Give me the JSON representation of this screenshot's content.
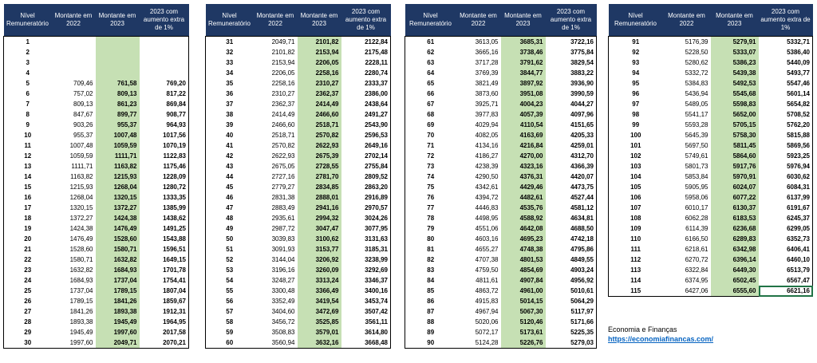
{
  "headers": {
    "level": "Nível Remuneratório",
    "amount2022": "Montante em 2022",
    "amount2023": "Montante em 2023",
    "amount2023_1pct": "2023 com aumento extra de 1%"
  },
  "tables": [
    {
      "rows": [
        [
          "1",
          "",
          "",
          ""
        ],
        [
          "2",
          "",
          "",
          ""
        ],
        [
          "3",
          "",
          "",
          ""
        ],
        [
          "4",
          "",
          "",
          ""
        ],
        [
          "5",
          "709,46",
          "761,58",
          "769,20"
        ],
        [
          "6",
          "757,02",
          "809,13",
          "817,22"
        ],
        [
          "7",
          "809,13",
          "861,23",
          "869,84"
        ],
        [
          "8",
          "847,67",
          "899,77",
          "908,77"
        ],
        [
          "9",
          "903,26",
          "955,37",
          "964,93"
        ],
        [
          "10",
          "955,37",
          "1007,48",
          "1017,56"
        ],
        [
          "11",
          "1007,48",
          "1059,59",
          "1070,19"
        ],
        [
          "12",
          "1059,59",
          "1111,71",
          "1122,83"
        ],
        [
          "13",
          "1111,71",
          "1163,82",
          "1175,46"
        ],
        [
          "14",
          "1163,82",
          "1215,93",
          "1228,09"
        ],
        [
          "15",
          "1215,93",
          "1268,04",
          "1280,72"
        ],
        [
          "16",
          "1268,04",
          "1320,15",
          "1333,35"
        ],
        [
          "17",
          "1320,15",
          "1372,27",
          "1385,99"
        ],
        [
          "18",
          "1372,27",
          "1424,38",
          "1438,62"
        ],
        [
          "19",
          "1424,38",
          "1476,49",
          "1491,25"
        ],
        [
          "20",
          "1476,49",
          "1528,60",
          "1543,88"
        ],
        [
          "21",
          "1528,60",
          "1580,71",
          "1596,51"
        ],
        [
          "22",
          "1580,71",
          "1632,82",
          "1649,15"
        ],
        [
          "23",
          "1632,82",
          "1684,93",
          "1701,78"
        ],
        [
          "24",
          "1684,93",
          "1737,04",
          "1754,41"
        ],
        [
          "25",
          "1737,04",
          "1789,15",
          "1807,04"
        ],
        [
          "26",
          "1789,15",
          "1841,26",
          "1859,67"
        ],
        [
          "27",
          "1841,26",
          "1893,38",
          "1912,31"
        ],
        [
          "28",
          "1893,38",
          "1945,49",
          "1964,95"
        ],
        [
          "29",
          "1945,49",
          "1997,60",
          "2017,58"
        ],
        [
          "30",
          "1997,60",
          "2049,71",
          "2070,21"
        ]
      ]
    },
    {
      "rows": [
        [
          "31",
          "2049,71",
          "2101,82",
          "2122,84"
        ],
        [
          "32",
          "2101,82",
          "2153,94",
          "2175,48"
        ],
        [
          "33",
          "2153,94",
          "2206,05",
          "2228,11"
        ],
        [
          "34",
          "2206,05",
          "2258,16",
          "2280,74"
        ],
        [
          "35",
          "2258,16",
          "2310,27",
          "2333,37"
        ],
        [
          "36",
          "2310,27",
          "2362,37",
          "2386,00"
        ],
        [
          "37",
          "2362,37",
          "2414,49",
          "2438,64"
        ],
        [
          "38",
          "2414,49",
          "2466,60",
          "2491,27"
        ],
        [
          "39",
          "2466,60",
          "2518,71",
          "2543,90"
        ],
        [
          "40",
          "2518,71",
          "2570,82",
          "2596,53"
        ],
        [
          "41",
          "2570,82",
          "2622,93",
          "2649,16"
        ],
        [
          "42",
          "2622,93",
          "2675,39",
          "2702,14"
        ],
        [
          "43",
          "2675,05",
          "2728,55",
          "2755,84"
        ],
        [
          "44",
          "2727,16",
          "2781,70",
          "2809,52"
        ],
        [
          "45",
          "2779,27",
          "2834,85",
          "2863,20"
        ],
        [
          "46",
          "2831,38",
          "2888,01",
          "2916,89"
        ],
        [
          "47",
          "2883,49",
          "2941,16",
          "2970,57"
        ],
        [
          "48",
          "2935,61",
          "2994,32",
          "3024,26"
        ],
        [
          "49",
          "2987,72",
          "3047,47",
          "3077,95"
        ],
        [
          "50",
          "3039,83",
          "3100,62",
          "3131,63"
        ],
        [
          "51",
          "3091,93",
          "3153,77",
          "3185,31"
        ],
        [
          "52",
          "3144,04",
          "3206,92",
          "3238,99"
        ],
        [
          "53",
          "3196,16",
          "3260,09",
          "3292,69"
        ],
        [
          "54",
          "3248,27",
          "3313,24",
          "3346,37"
        ],
        [
          "55",
          "3300,48",
          "3366,49",
          "3400,16"
        ],
        [
          "56",
          "3352,49",
          "3419,54",
          "3453,74"
        ],
        [
          "57",
          "3404,60",
          "3472,69",
          "3507,42"
        ],
        [
          "58",
          "3456,72",
          "3525,85",
          "3561,11"
        ],
        [
          "59",
          "3508,83",
          "3579,01",
          "3614,80"
        ],
        [
          "60",
          "3560,94",
          "3632,16",
          "3668,48"
        ]
      ]
    },
    {
      "rows": [
        [
          "61",
          "3613,05",
          "3685,31",
          "3722,16"
        ],
        [
          "62",
          "3665,16",
          "3738,46",
          "3775,84"
        ],
        [
          "63",
          "3717,28",
          "3791,62",
          "3829,54"
        ],
        [
          "64",
          "3769,39",
          "3844,77",
          "3883,22"
        ],
        [
          "65",
          "3821,49",
          "3897,92",
          "3936,90"
        ],
        [
          "66",
          "3873,60",
          "3951,08",
          "3990,59"
        ],
        [
          "67",
          "3925,71",
          "4004,23",
          "4044,27"
        ],
        [
          "68",
          "3977,83",
          "4057,39",
          "4097,96"
        ],
        [
          "69",
          "4029,94",
          "4110,54",
          "4151,65"
        ],
        [
          "70",
          "4082,05",
          "4163,69",
          "4205,33"
        ],
        [
          "71",
          "4134,16",
          "4216,84",
          "4259,01"
        ],
        [
          "72",
          "4186,27",
          "4270,00",
          "4312,70"
        ],
        [
          "73",
          "4238,39",
          "4323,16",
          "4366,39"
        ],
        [
          "74",
          "4290,50",
          "4376,31",
          "4420,07"
        ],
        [
          "75",
          "4342,61",
          "4429,46",
          "4473,75"
        ],
        [
          "76",
          "4394,72",
          "4482,61",
          "4527,44"
        ],
        [
          "77",
          "4446,83",
          "4535,76",
          "4581,12"
        ],
        [
          "78",
          "4498,95",
          "4588,92",
          "4634,81"
        ],
        [
          "79",
          "4551,06",
          "4642,08",
          "4688,50"
        ],
        [
          "80",
          "4603,16",
          "4695,23",
          "4742,18"
        ],
        [
          "81",
          "4655,27",
          "4748,38",
          "4795,86"
        ],
        [
          "82",
          "4707,38",
          "4801,53",
          "4849,55"
        ],
        [
          "83",
          "4759,50",
          "4854,69",
          "4903,24"
        ],
        [
          "84",
          "4811,61",
          "4907,84",
          "4956,92"
        ],
        [
          "85",
          "4863,72",
          "4961,00",
          "5010,61"
        ],
        [
          "86",
          "4915,83",
          "5014,15",
          "5064,29"
        ],
        [
          "87",
          "4967,94",
          "5067,30",
          "5117,97"
        ],
        [
          "88",
          "5020,06",
          "5120,46",
          "5171,66"
        ],
        [
          "89",
          "5072,17",
          "5173,61",
          "5225,35"
        ],
        [
          "90",
          "5124,28",
          "5226,76",
          "5279,03"
        ]
      ]
    },
    {
      "rows": [
        [
          "91",
          "5176,39",
          "5279,91",
          "5332,71"
        ],
        [
          "92",
          "5228,50",
          "5333,07",
          "5386,40"
        ],
        [
          "93",
          "5280,62",
          "5386,23",
          "5440,09"
        ],
        [
          "94",
          "5332,72",
          "5439,38",
          "5493,77"
        ],
        [
          "95",
          "5384,83",
          "5492,53",
          "5547,46"
        ],
        [
          "96",
          "5436,94",
          "5545,68",
          "5601,14"
        ],
        [
          "97",
          "5489,05",
          "5598,83",
          "5654,82"
        ],
        [
          "98",
          "5541,17",
          "5652,00",
          "5708,52"
        ],
        [
          "99",
          "5593,28",
          "5705,15",
          "5762,20"
        ],
        [
          "100",
          "5645,39",
          "5758,30",
          "5815,88"
        ],
        [
          "101",
          "5697,50",
          "5811,45",
          "5869,56"
        ],
        [
          "102",
          "5749,61",
          "5864,60",
          "5923,25"
        ],
        [
          "103",
          "5801,73",
          "5917,76",
          "5976,94"
        ],
        [
          "104",
          "5853,84",
          "5970,91",
          "6030,62"
        ],
        [
          "105",
          "5905,95",
          "6024,07",
          "6084,31"
        ],
        [
          "106",
          "5958,06",
          "6077,22",
          "6137,99"
        ],
        [
          "107",
          "6010,17",
          "6130,37",
          "6191,67"
        ],
        [
          "108",
          "6062,28",
          "6183,53",
          "6245,37"
        ],
        [
          "109",
          "6114,39",
          "6236,68",
          "6299,05"
        ],
        [
          "110",
          "6166,50",
          "6289,83",
          "6352,73"
        ],
        [
          "111",
          "6218,61",
          "6342,98",
          "6406,41"
        ],
        [
          "112",
          "6270,72",
          "6396,14",
          "6460,10"
        ],
        [
          "113",
          "6322,84",
          "6449,30",
          "6513,79"
        ],
        [
          "114",
          "6374,95",
          "6502,45",
          "6567,47"
        ],
        [
          "115",
          "6427,06",
          "6555,60",
          "6621,16"
        ]
      ]
    }
  ],
  "footer": {
    "text": "Economia e Finanças",
    "link": "https://economiafinancas.com/"
  },
  "colors": {
    "header_bg": "#1f3864",
    "highlight_green": "#c6e0b4",
    "link_blue": "#0563c1"
  }
}
